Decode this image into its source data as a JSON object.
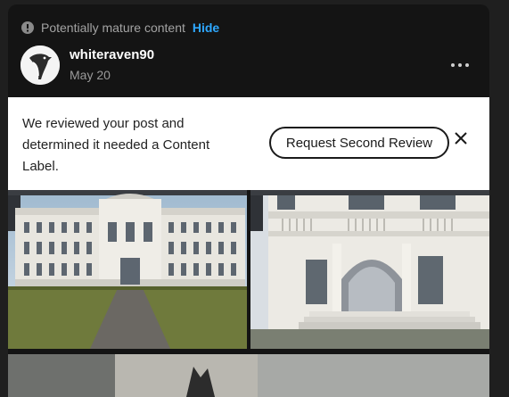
{
  "warning": {
    "icon": "info-icon",
    "text": "Potentially mature content",
    "hide_label": "Hide"
  },
  "post": {
    "username": "whiteraven90",
    "date": "May 20",
    "avatar_icon": "raven-avatar",
    "more_icon": "more-dots-icon"
  },
  "notice": {
    "line1": "We reviewed your post and",
    "line2": "determined it needed a Content",
    "line3": "Label.",
    "button_label": "Request Second Review",
    "close_icon": "close-icon"
  },
  "images": [
    {
      "subject": "palace-exterior-render"
    },
    {
      "subject": "palace-entrance-render"
    },
    {
      "subject": "render-partial"
    }
  ],
  "colors": {
    "page_bg": "#1f1f1f",
    "card_bg": "#141414",
    "link": "#2ea8ff",
    "notice_bg": "#ffffff"
  }
}
